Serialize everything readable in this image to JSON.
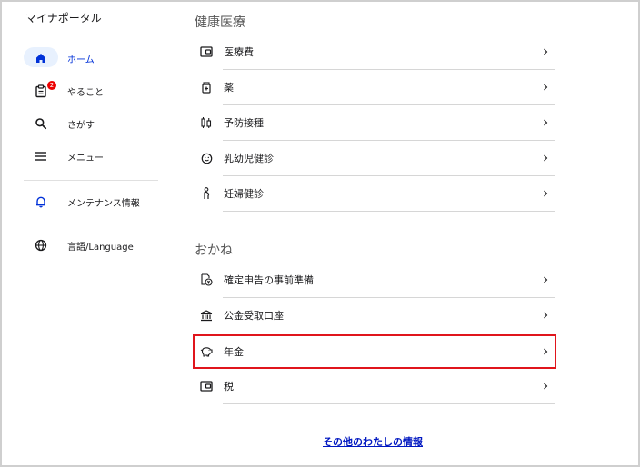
{
  "sidebar": {
    "app_title": "マイナポータル",
    "items": [
      {
        "label": "ホーム",
        "icon": "home-icon",
        "active": true
      },
      {
        "label": "やること",
        "icon": "task-list-icon",
        "badge": "2"
      },
      {
        "label": "さがす",
        "icon": "search-icon"
      },
      {
        "label": "メニュー",
        "icon": "menu-icon"
      },
      {
        "label": "メンテナンス情報",
        "icon": "bell-icon"
      },
      {
        "label": "言語/Language",
        "icon": "globe-icon"
      }
    ]
  },
  "main": {
    "sections": [
      {
        "title": "健康医療",
        "rows": [
          {
            "label": "医療費",
            "icon": "wallet-icon"
          },
          {
            "label": "薬",
            "icon": "medicine-icon"
          },
          {
            "label": "予防接種",
            "icon": "syringe-icon"
          },
          {
            "label": "乳幼児健診",
            "icon": "baby-face-icon"
          },
          {
            "label": "妊婦健診",
            "icon": "pregnant-icon"
          }
        ]
      },
      {
        "title": "おかね",
        "rows": [
          {
            "label": "確定申告の事前準備",
            "icon": "tax-document-icon"
          },
          {
            "label": "公金受取口座",
            "icon": "bank-icon"
          },
          {
            "label": "年金",
            "icon": "piggy-bank-icon",
            "highlighted": true
          },
          {
            "label": "税",
            "icon": "wallet-icon"
          }
        ]
      }
    ],
    "more_link": "その他のわたしの情報"
  },
  "colors": {
    "accent_blue": "#0031d8",
    "active_pill": "#e8f1fe",
    "badge_red": "#ec0000",
    "highlight_red": "#e0151c",
    "link_blue": "#0017c1"
  }
}
